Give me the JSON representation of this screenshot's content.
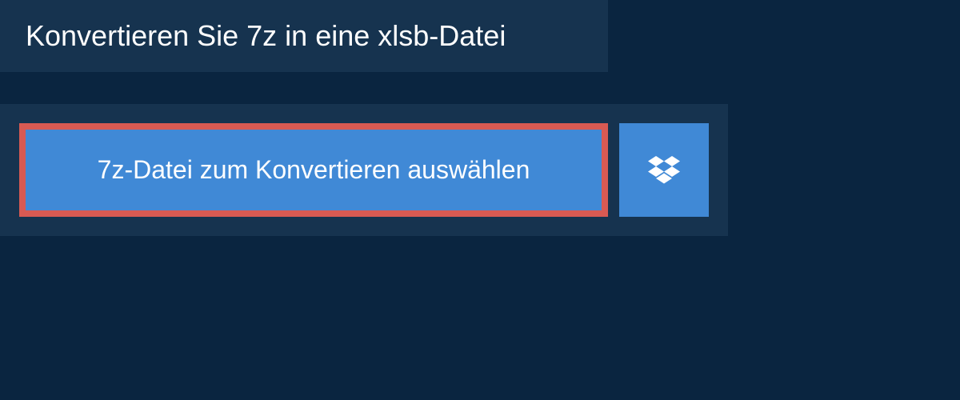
{
  "header": {
    "title": "Konvertieren Sie 7z in eine xlsb-Datei"
  },
  "actions": {
    "select_file_label": "7z-Datei zum Konvertieren auswählen"
  },
  "colors": {
    "background": "#0a2540",
    "panel": "#16334f",
    "button": "#4089d6",
    "highlight_border": "#d85a53"
  }
}
